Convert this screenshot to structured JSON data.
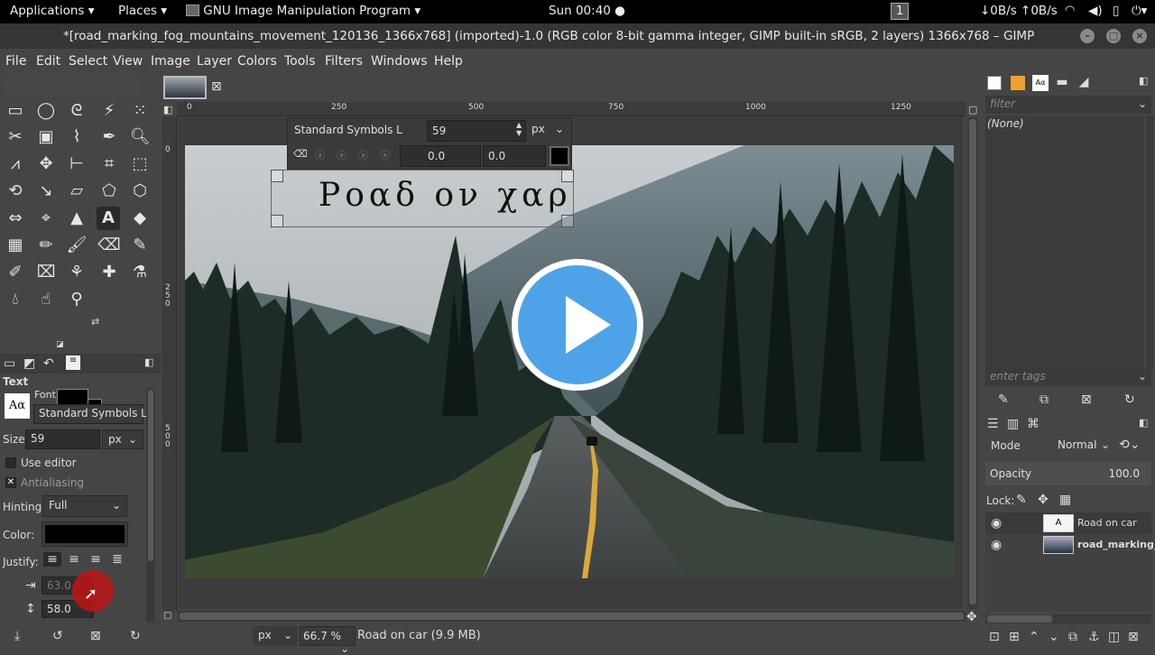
{
  "topbar": {
    "applications": "Applications",
    "places": "Places",
    "app": "GNU Image Manipulation Program",
    "clock": "Sun 00:40",
    "workspace": "1",
    "net": "↓0B/s ↑0B/s"
  },
  "window": {
    "title": "*[road_marking_fog_mountains_movement_120136_1366x768] (imported)-1.0 (RGB color 8-bit gamma integer, GIMP built-in sRGB, 2 layers) 1366x768 – GIMP"
  },
  "menu": [
    "File",
    "Edit",
    "Select",
    "View",
    "Image",
    "Layer",
    "Colors",
    "Tools",
    "Filters",
    "Windows",
    "Help"
  ],
  "tool_options": {
    "title": "Text",
    "font_label": "Font",
    "font_value": "Standard Symbols L",
    "size_label": "Size:",
    "size_value": "59",
    "unit": "px",
    "use_editor": "Use editor",
    "antialiasing": "Antialiasing",
    "hinting_label": "Hinting:",
    "hinting_value": "Full",
    "color_label": "Color:",
    "justify_label": "Justify:",
    "indent_value": "63.0",
    "line_spacing_value": "58.0"
  },
  "text_toolbar": {
    "font": "Standard Symbols L",
    "size": "59",
    "unit": "px",
    "baseline": "0.0",
    "kerning": "0.0"
  },
  "canvas": {
    "text_on_image": "Ροαδ ον χαρ",
    "ruler_marks": [
      "0",
      "250",
      "500",
      "750",
      "1000",
      "1250"
    ],
    "left_ruler": [
      "0",
      "2 5 0",
      "5 0 0"
    ]
  },
  "status": {
    "unit": "px",
    "zoom": "66.7 %",
    "layer_info": "Road on car (9.9 MB)"
  },
  "right": {
    "filter_placeholder": "filter",
    "none": "(None)",
    "tags_placeholder": "enter tags",
    "mode_label": "Mode",
    "mode_value": "Normal",
    "opacity_label": "Opacity",
    "opacity_value": "100.0",
    "lock_label": "Lock:",
    "layers": [
      "Road on car",
      "road_marking_"
    ]
  }
}
